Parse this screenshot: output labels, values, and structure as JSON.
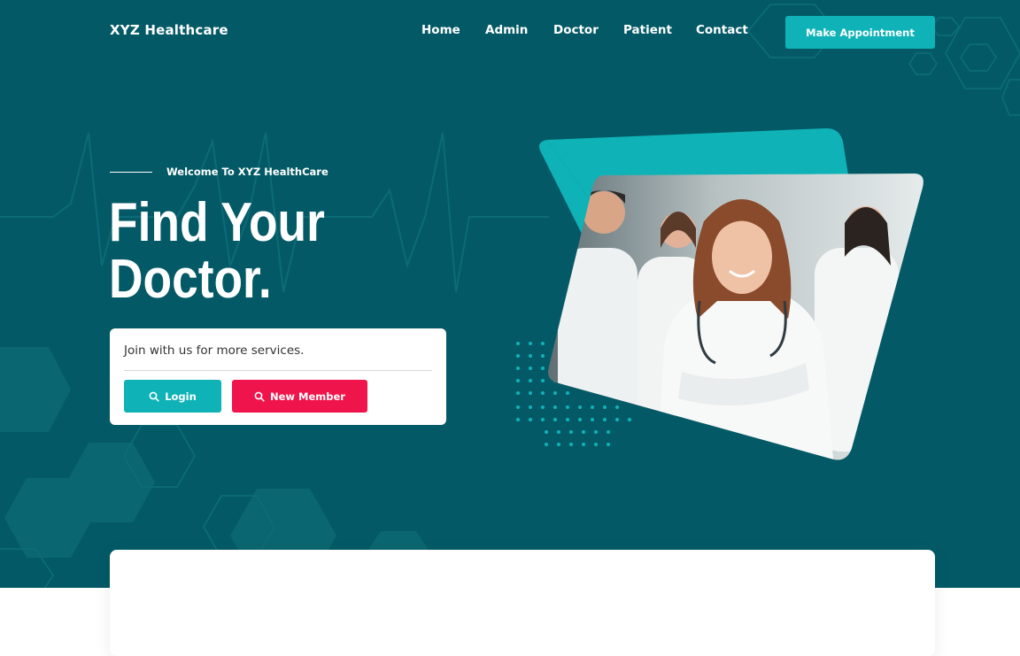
{
  "header": {
    "brand": "XYZ Healthcare",
    "nav": [
      {
        "label": "Home"
      },
      {
        "label": "Admin"
      },
      {
        "label": "Doctor"
      },
      {
        "label": "Patient"
      },
      {
        "label": "Contact"
      }
    ],
    "cta_label": "Make Appointment"
  },
  "hero": {
    "welcome": "Welcome To XYZ HealthCare",
    "headline_line1": "Find Your",
    "headline_line2": "Doctor.",
    "join_text": "Join with us for more services.",
    "login_label": "Login",
    "login_icon": "search-icon",
    "member_label": "New Member",
    "member_icon": "search-icon",
    "image": "doctors-group-photo"
  },
  "colors": {
    "hero_bg": "#035a66",
    "accent": "#0fb3b7",
    "danger": "#f0144c"
  }
}
